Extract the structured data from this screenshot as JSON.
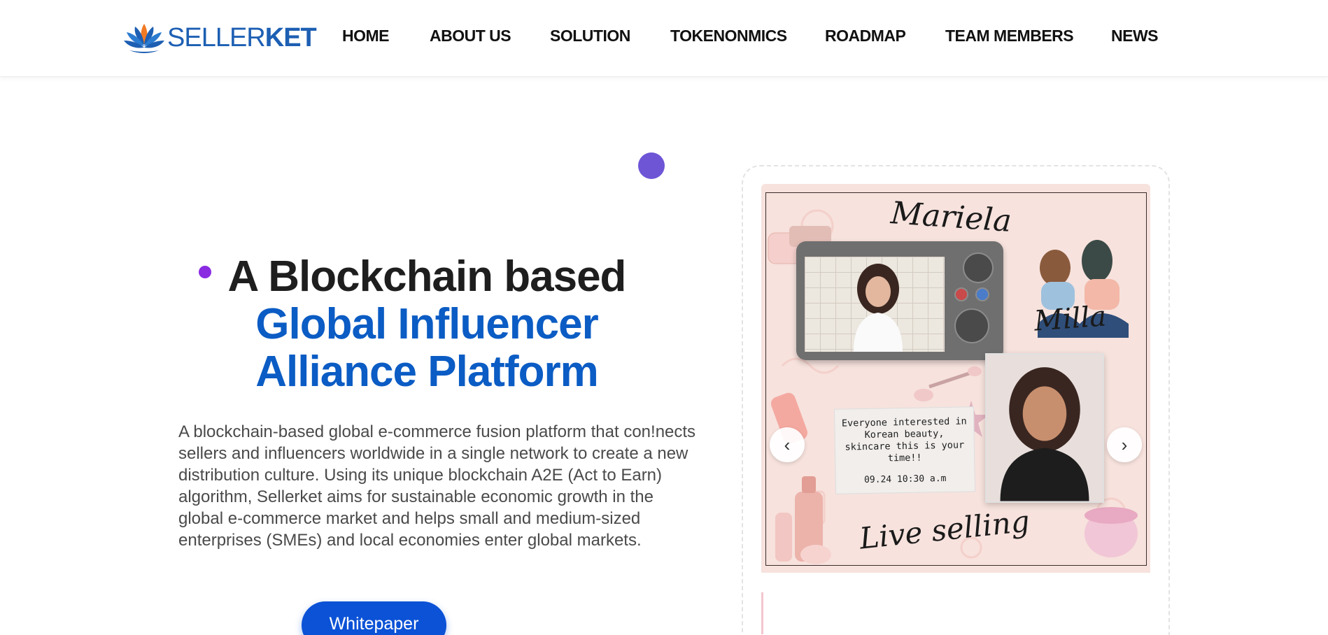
{
  "brand": {
    "name_part1": "SELLER",
    "name_part2": "KET",
    "logo_icon": "lotus-icon",
    "colors": {
      "brand_blue": "#1d5fb3",
      "lotus_orange": "#f07a24"
    }
  },
  "nav": {
    "items": [
      "HOME",
      "ABOUT US",
      "SOLUTION",
      "TOKENONMICS",
      "ROADMAP",
      "TEAM MEMBERS",
      "NEWS"
    ]
  },
  "hero": {
    "title_line1": "A Blockchain based",
    "title_line2": "Global Influencer",
    "title_line3": "Alliance Platform",
    "description": "A blockchain-based global e-commerce fusion platform that con!nects sellers and influencers worldwide in a single network to create a new distribution culture. Using its unique blockchain A2E (Act to Earn) algorithm, Sellerket aims for sustainable economic growth in the global e-commerce market and helps small and medium-sized enterprises (SMEs) and local economies enter global markets.",
    "button_label": "Whitepaper",
    "colors": {
      "title_dark": "#1e1e1e",
      "title_blue": "#0b5cc4",
      "button_bg": "#0b52d6",
      "dot_purple": "#6e55d6"
    }
  },
  "slider": {
    "poster": {
      "name1": "Mariela",
      "name2": "Milla",
      "tagline": "Live selling",
      "note_text": "Everyone interested in Korean beauty, skincare this is your time!!",
      "note_date": "09.24 10:30 a.m"
    },
    "prev_icon": "chevron-left-icon",
    "next_icon": "chevron-right-icon",
    "prev_glyph": "‹",
    "next_glyph": "›"
  }
}
